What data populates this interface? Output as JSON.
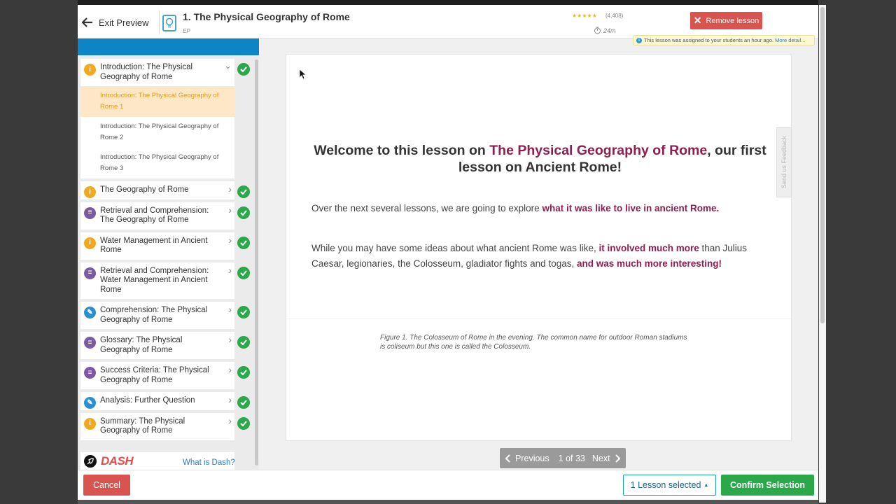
{
  "header": {
    "exit_label": "Exit Preview",
    "lesson_title": "1. The Physical Geography of Rome",
    "lesson_sub": "EP",
    "stars": "★★★★★",
    "rating_count": "(4,408)",
    "duration": "24m",
    "remove_label": "Remove lesson",
    "assigned_note": "This lesson was assigned to your students an hour ago.",
    "more_details": "More detail..."
  },
  "sidebar": {
    "items": [
      {
        "label": "Introduction: The Physical Geography of Rome",
        "icon": "info-icon",
        "expanded": true
      },
      {
        "label": "The Geography of Rome",
        "icon": "info-icon"
      },
      {
        "label": "Retrieval and Comprehension: The Geography of Rome",
        "icon": "list-icon"
      },
      {
        "label": "Water Management in Ancient Rome",
        "icon": "info-icon"
      },
      {
        "label": "Retrieval and Comprehension: Water Management in Ancient Rome",
        "icon": "list-icon"
      },
      {
        "label": "Comprehension: The Physical Geography of Rome",
        "icon": "pencil-icon"
      },
      {
        "label": "Glossary: The Physical Geography of Rome",
        "icon": "list-icon"
      },
      {
        "label": "Success Criteria: The Physical Geography of Rome",
        "icon": "list-icon"
      },
      {
        "label": "Analysis: Further Question",
        "icon": "pencil-icon"
      },
      {
        "label": "Summary: The Physical Geography of Rome",
        "icon": "info-icon"
      }
    ],
    "subitems": [
      "Introduction: The Physical Geography of Rome 1",
      "Introduction: The Physical Geography of Rome 2",
      "Introduction: The Physical Geography of Rome 3"
    ],
    "dash_label": "DASH",
    "what_dash": "What is Dash?"
  },
  "content": {
    "welcome_pre": "Welcome to this lesson on",
    "welcome_hl": "The Physical Geography of Rome",
    "welcome_post": ", our first lesson on Ancient Rome!",
    "p1_pre": "Over the next several lessons, we are going to explore",
    "p1_hl": "what it was like to live in ancient Rome.",
    "p2_pre": "While you may have some ideas about what ancient Rome was like,",
    "p2_hl1": "it involved much more",
    "p2_mid": "than Julius Caesar, legionaries, the Colosseum, gladiator fights and togas,",
    "p2_hl2": "and was much more interesting!",
    "caption": "Figure 1. The Colosseum of Rome in the evening. The common name for outdoor Roman stadiums is coliseum but this one is called the Colosseum.",
    "feedback": "Send us Feedback"
  },
  "pager": {
    "prev": "Previous",
    "count": "1 of 33",
    "next": "Next"
  },
  "footer": {
    "cancel": "Cancel",
    "selected": "1 Lesson selected",
    "confirm": "Confirm Selection"
  },
  "colors": {
    "accent_blue": "#0d84c6",
    "maroon": "#8e1e4f",
    "success": "#2aa84a",
    "danger": "#d9534f"
  }
}
